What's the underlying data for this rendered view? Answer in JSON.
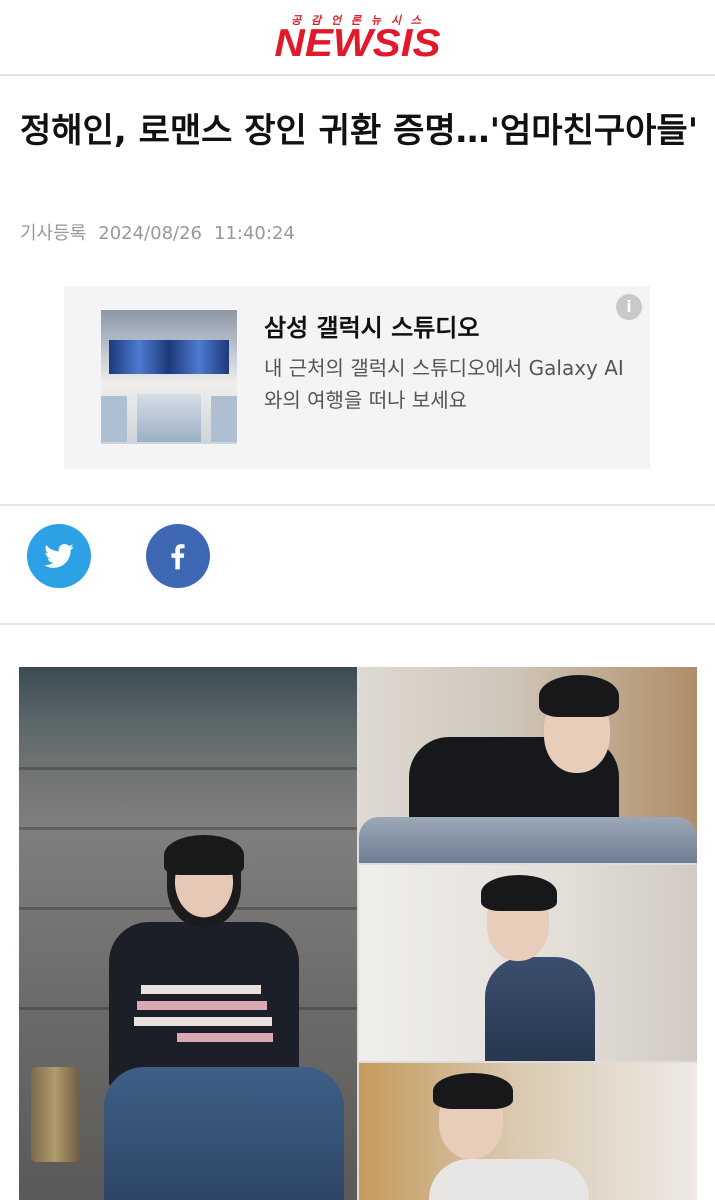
{
  "header": {
    "tagline": "공 감 언 론 뉴 시 스",
    "logo": "NEWSIS",
    "brand_color": "#e2182b"
  },
  "article": {
    "title": "정해인, 로맨스 장인 귀환 증명…'엄마친구아들'",
    "meta_label": "기사등록",
    "date": "2024/08/26",
    "time": "11:40:24"
  },
  "ad": {
    "title": "삼성 갤럭시 스튜디오",
    "description": "내 근처의 갤럭시 스튜디오에서 Galaxy AI와의 여행을 떠나 보세요",
    "info_icon": "info-icon",
    "info_glyph": "i"
  },
  "share": {
    "twitter_icon": "twitter-icon",
    "facebook_icon": "facebook-icon",
    "twitter_color": "#2da1e6",
    "facebook_color": "#3e68b4"
  },
  "photo": {
    "description_icon": "article-photo-collage"
  }
}
